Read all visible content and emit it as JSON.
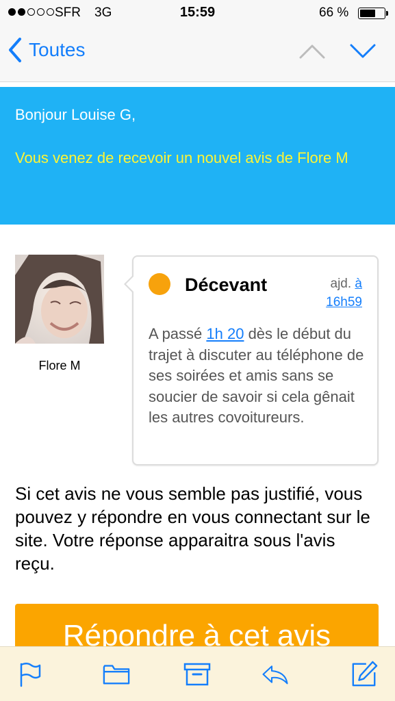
{
  "status_bar": {
    "carrier": "SFR",
    "network": "3G",
    "time": "15:59",
    "battery": "66 %",
    "battery_level": 0.66,
    "signal_strength": 2
  },
  "nav": {
    "back_label": "Toutes",
    "icons": [
      "chevron-left-icon",
      "chevron-up-icon",
      "chevron-down-icon"
    ]
  },
  "email": {
    "greeting": "Bonjour Louise G,",
    "intro": "Vous venez de recevoir un nouvel avis de Flore M",
    "banner_color": "#1fb2f5",
    "intro_color": "#fff533"
  },
  "review": {
    "reviewer_name": "Flore M",
    "rating_label": "Décevant",
    "rating_color": "#f7a20c",
    "date_prefix": "ajd.",
    "date_link_1": "à",
    "date_link_2": "16h59",
    "text_before": "A passé ",
    "text_link": "1h 20",
    "text_after": " dès le début du trajet à discuter au téléphone de ses soirées et amis sans se soucier de savoir si cela gênait les autres covoitureurs."
  },
  "explanation": "Si cet avis ne vous semble pas justifié, vous pouvez y répondre en vous connectant sur le site. Votre réponse apparaitra sous l'avis reçu.",
  "cta": {
    "label": "Répondre à cet avis",
    "color": "#fba500"
  },
  "toolbar": {
    "icons": [
      "flag-icon",
      "folder-icon",
      "archive-icon",
      "reply-icon",
      "compose-icon"
    ],
    "accent": "#147efb"
  }
}
